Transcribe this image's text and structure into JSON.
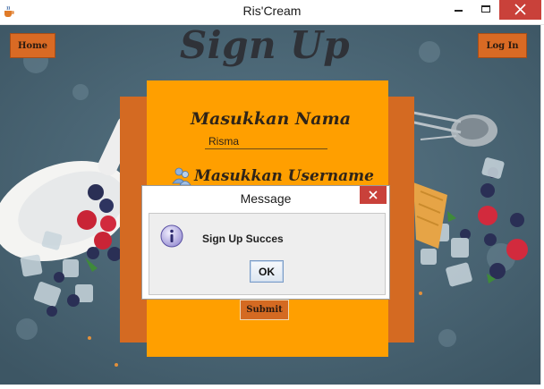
{
  "window": {
    "title": "Ris'Cream",
    "icon": "java-cup-icon"
  },
  "nav": {
    "home_label": "Home",
    "login_label": "Log In"
  },
  "page": {
    "title": "Sign Up"
  },
  "form": {
    "name_label": "Masukkan Nama",
    "name_value": "Risma",
    "username_label": "Masukkan Username",
    "username_icon": "users-icon",
    "submit_label": "Submit"
  },
  "dialog": {
    "title": "Message",
    "message": "Sign Up Succes",
    "icon": "info-icon",
    "ok_label": "OK"
  },
  "colors": {
    "orange_panel": "#ff9f00",
    "dark_orange": "#d46a22",
    "close_red": "#c9413a"
  }
}
